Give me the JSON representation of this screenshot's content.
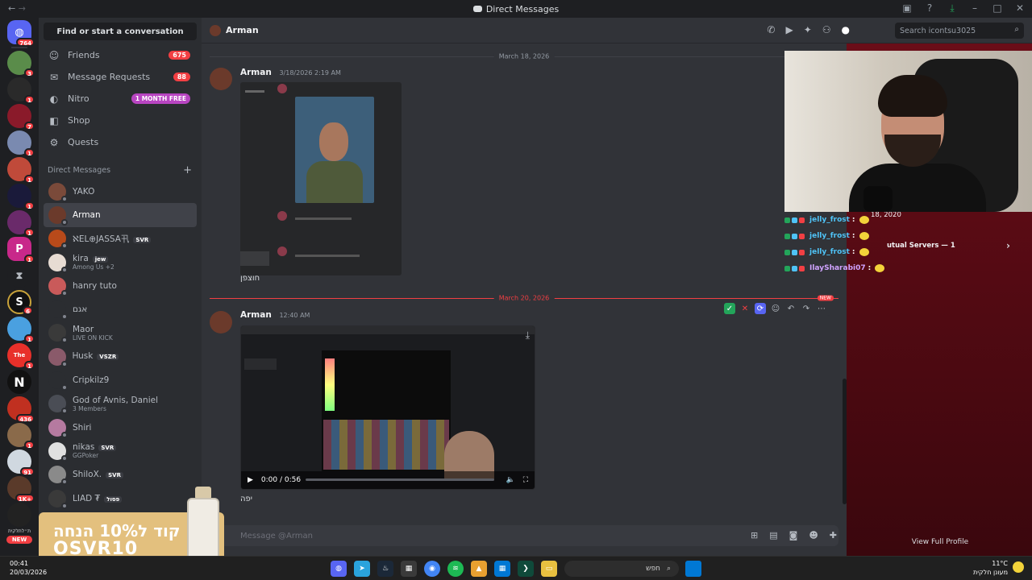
{
  "window": {
    "title": "Direct Messages",
    "back": "←",
    "forward": "→"
  },
  "rail": {
    "badges": [
      "764",
      "3",
      "1",
      "7",
      "1",
      "1",
      "1",
      "1",
      "1",
      "1",
      "6",
      "1",
      "1",
      "1",
      "436",
      "1",
      "91",
      "1K+"
    ],
    "new_label": "NEW",
    "partial_label": "ת״לתלקית"
  },
  "sidebar": {
    "search_label": "Find or start a conversation",
    "nav": [
      {
        "label": "Friends",
        "icon": "friends-icon",
        "badge": "675"
      },
      {
        "label": "Message Requests",
        "icon": "envelope-icon",
        "badge": "88"
      },
      {
        "label": "Nitro",
        "icon": "nitro-icon",
        "badge": "1 MONTH FREE"
      },
      {
        "label": "Shop",
        "icon": "shop-icon",
        "badge": ""
      },
      {
        "label": "Quests",
        "icon": "quests-icon",
        "badge": ""
      }
    ],
    "dm_heading": "Direct Messages",
    "dm_add": "+",
    "dms": [
      {
        "name": "YAKO",
        "sub": "",
        "tag": "",
        "color": "#7a4a3a"
      },
      {
        "name": "Arman",
        "sub": "",
        "tag": "",
        "color": "#6b3a2b"
      },
      {
        "name": "ℵEL⊕JASSA卂",
        "sub": "",
        "tag": "SVR",
        "color": "#b84a1a"
      },
      {
        "name": "kira",
        "sub": "Among Us +2",
        "tag": "jew",
        "color": "#e7dcd3"
      },
      {
        "name": "hanry tuto",
        "sub": "",
        "tag": "",
        "color": "#c95a5a"
      },
      {
        "name": "אגם",
        "sub": "",
        "tag": "",
        "color": "#2b2d31"
      },
      {
        "name": "Maor",
        "sub": "LIVE ON KICK",
        "tag": "",
        "color": "#3a3a3a"
      },
      {
        "name": "Ꮋusk",
        "sub": "",
        "tag": "VSZR",
        "color": "#8a5a6a"
      },
      {
        "name": "Cripkilz9",
        "sub": "",
        "tag": "",
        "color": "#2b2d31"
      },
      {
        "name": "God of Avnis, Daniel",
        "sub": "3 Members",
        "tag": "",
        "color": "#4a4d55"
      },
      {
        "name": "Shiri",
        "sub": "",
        "tag": "",
        "color": "#b57aa0"
      },
      {
        "name": "nikas",
        "sub": "GGPoker",
        "tag": "SVR",
        "color": "#e0e0e0"
      },
      {
        "name": "ShiloX.",
        "sub": "",
        "tag": "SVR",
        "color": "#8a8a8a"
      },
      {
        "name": "LIAD ₮",
        "sub": "",
        "tag": "פסול",
        "color": "#3a3a3a"
      }
    ]
  },
  "promo": {
    "line1": "קוד ל10% הנחה",
    "line2": "OSVR10"
  },
  "header": {
    "dm_name": "Arman",
    "search_placeholder": "Search icontsu3025"
  },
  "messages": {
    "divider1": "March 18, 2026",
    "divider2": "March 20, 2026",
    "new_badge": "NEW",
    "m1": {
      "author": "Arman",
      "time": "3/18/2026 2:19 AM",
      "text": "חוצפן"
    },
    "m2": {
      "author": "Arman",
      "time": "12:40 AM",
      "text": "יפה"
    },
    "video": {
      "time": "0:00 / 0:56",
      "progress": 0
    }
  },
  "composer": {
    "placeholder": "Message @Arman"
  },
  "profile": {
    "member_since": "18, 2020",
    "mutual_servers": "utual Servers — 1",
    "view_full": "View Full Profile"
  },
  "chat_overlay": [
    {
      "user": "jelly_frost",
      "sep": ":",
      "color": "#4fc3f7"
    },
    {
      "user": "jelly_frost",
      "sep": ":",
      "color": "#4fc3f7"
    },
    {
      "user": "jelly_frost",
      "sep": ":",
      "color": "#4fc3f7"
    },
    {
      "user": "IlaySharabi07",
      "sep": ":",
      "color": "#d0a3ff"
    }
  ],
  "taskbar": {
    "time": "00:41",
    "date": "20/03/2026",
    "search": "חפש",
    "temp": "11°C",
    "weather": "מעונן חלקית"
  }
}
